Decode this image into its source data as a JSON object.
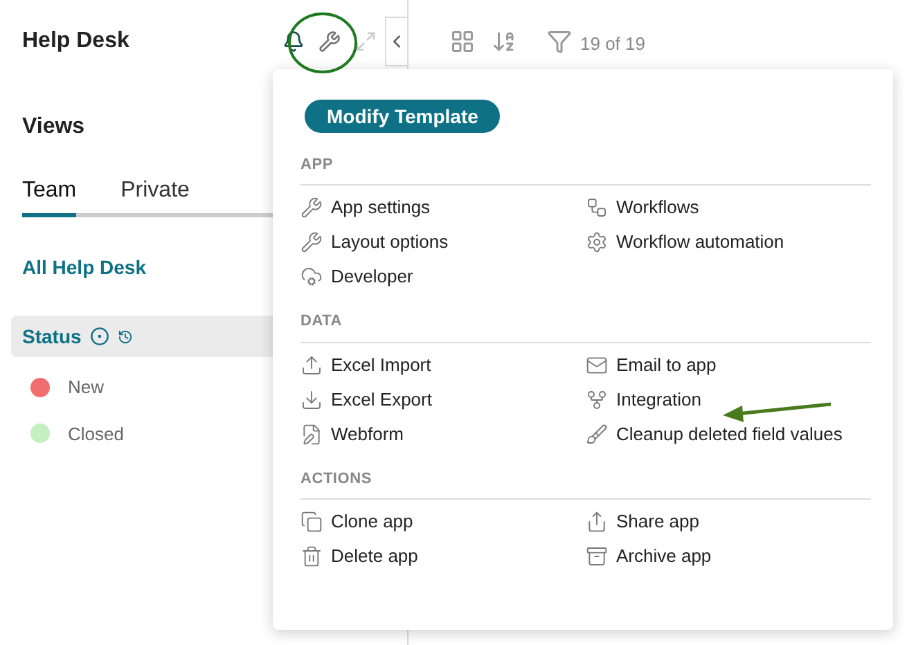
{
  "app": {
    "title": "Help Desk"
  },
  "toolbar": {
    "record_count": "19 of 19"
  },
  "sidebar": {
    "heading": "Views",
    "tabs": [
      {
        "label": "Team",
        "selected": true
      },
      {
        "label": "Private",
        "selected": false
      }
    ],
    "view_link": "All Help Desk",
    "group": {
      "label": "Status"
    },
    "statuses": [
      {
        "label": "New",
        "color": "#f26d6d"
      },
      {
        "label": "Closed",
        "color": "#c4f0bf"
      }
    ]
  },
  "menu": {
    "primary_button": "Modify Template",
    "sections": [
      {
        "title": "APP",
        "items": [
          "App settings",
          "Workflows",
          "Layout options",
          "Workflow automation",
          "Developer"
        ]
      },
      {
        "title": "DATA",
        "items": [
          "Excel Import",
          "Email to app",
          "Excel Export",
          "Integration",
          "Webform",
          "Cleanup deleted field values"
        ]
      },
      {
        "title": "ACTIONS",
        "items": [
          "Clone app",
          "Share app",
          "Delete app",
          "Archive app"
        ]
      }
    ]
  }
}
